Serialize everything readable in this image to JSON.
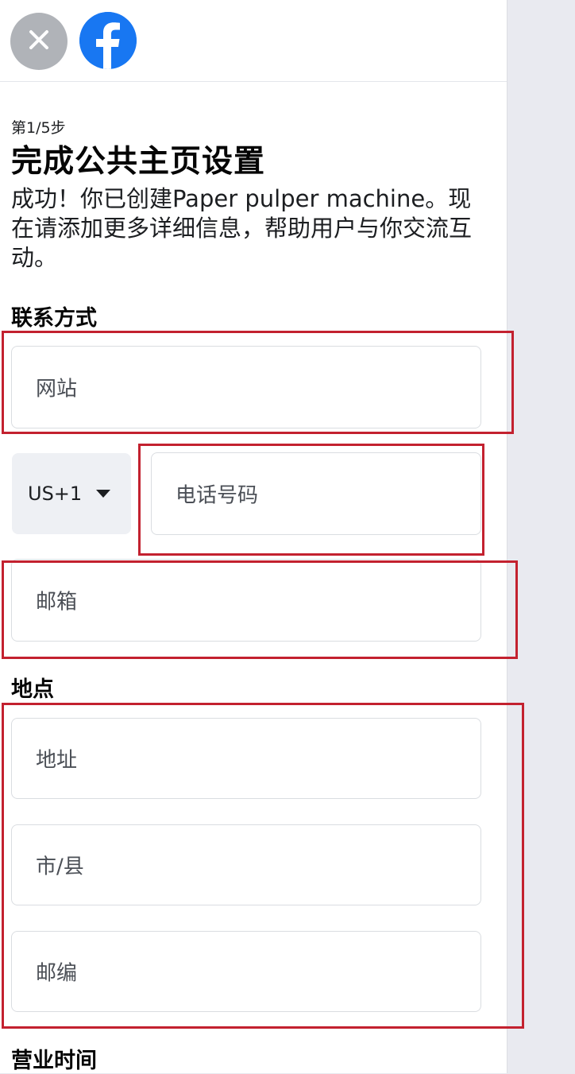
{
  "progress": {
    "step_text": "第1/5步"
  },
  "header": {
    "title": "完成公共主页设置",
    "description": "成功！你已创建Paper pulper machine。现在请添加更多详细信息，帮助用户与你交流互动。"
  },
  "contact": {
    "heading": "联系方式",
    "website_placeholder": "网站",
    "country_code": "US+1",
    "phone_placeholder": "电话号码",
    "email_placeholder": "邮箱"
  },
  "location": {
    "heading": "地点",
    "address_placeholder": "地址",
    "city_placeholder": "市/县",
    "zip_placeholder": "邮编"
  },
  "hours": {
    "heading": "营业时间"
  },
  "colors": {
    "brand": "#1877f2",
    "highlight": "#c3212f"
  }
}
